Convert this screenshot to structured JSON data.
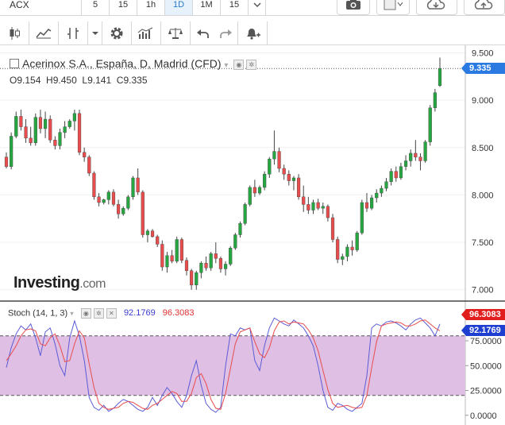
{
  "toolbar": {
    "symbol": "ACX",
    "timeframes": [
      {
        "label": "5",
        "active": false
      },
      {
        "label": "15",
        "active": false
      },
      {
        "label": "1h",
        "active": false
      },
      {
        "label": "1D",
        "active": true
      },
      {
        "label": "1M",
        "active": false
      },
      {
        "label": "15",
        "active": false
      }
    ],
    "icons": [
      "candlestick-icon",
      "line-chart-icon",
      "bar-chart-icon",
      "chevron-down-icon",
      "gear-icon",
      "indicators-icon",
      "scales-icon",
      "undo-icon",
      "redo-icon",
      "alert-bell-icon"
    ],
    "right_icons": [
      "camera-icon",
      "chart-type-icon",
      "cloud-download-icon",
      "cloud-upload-icon"
    ]
  },
  "main_panel": {
    "legend": "Acerinox S.A., España, D, Madrid (CFD)",
    "ohlc": {
      "o": "O9.154",
      "h": "H9.450",
      "l": "L9.141",
      "c": "C9.335"
    },
    "last_price": "9.335",
    "price_axis": [
      "9.500",
      "9.000",
      "8.500",
      "8.000",
      "7.500",
      "7.000"
    ],
    "logo": "Investing",
    "logo_suffix": ".com"
  },
  "stoch_panel": {
    "label": "Stoch (14, 1, 3)",
    "k_value": "92.1769",
    "d_value": "96.3083",
    "axis": [
      "75.0000",
      "50.0000",
      "25.0000",
      "0.0000"
    ]
  },
  "colors": {
    "up": "#26a641",
    "down": "#e84c4c",
    "k_line": "#5b5bd6",
    "d_line": "#e84c4c",
    "band": "#dfc0e4",
    "last_price_tag": "#2a7ae2"
  },
  "chart_data": [
    {
      "type": "candlestick",
      "title": "Acerinox S.A., España, D, Madrid (CFD)",
      "ylim": [
        6.88,
        9.58
      ],
      "candles": [
        [
          8.4,
          8.45,
          8.28,
          8.3
        ],
        [
          8.3,
          8.66,
          8.27,
          8.62
        ],
        [
          8.62,
          8.88,
          8.6,
          8.83
        ],
        [
          8.83,
          8.9,
          8.68,
          8.72
        ],
        [
          8.72,
          8.8,
          8.55,
          8.6
        ],
        [
          8.6,
          8.72,
          8.52,
          8.55
        ],
        [
          8.55,
          8.86,
          8.52,
          8.82
        ],
        [
          8.82,
          8.9,
          8.65,
          8.7
        ],
        [
          8.7,
          8.88,
          8.6,
          8.8
        ],
        [
          8.8,
          8.84,
          8.55,
          8.58
        ],
        [
          8.58,
          8.62,
          8.48,
          8.52
        ],
        [
          8.52,
          8.7,
          8.48,
          8.66
        ],
        [
          8.66,
          8.78,
          8.6,
          8.72
        ],
        [
          8.72,
          8.8,
          8.7,
          8.78
        ],
        [
          8.78,
          8.9,
          8.68,
          8.86
        ],
        [
          8.86,
          8.9,
          8.42,
          8.45
        ],
        [
          8.45,
          8.5,
          8.35,
          8.4
        ],
        [
          8.4,
          8.42,
          8.2,
          8.23
        ],
        [
          8.23,
          8.25,
          7.95,
          7.98
        ],
        [
          7.98,
          8.02,
          7.88,
          7.92
        ],
        [
          7.92,
          7.96,
          7.9,
          7.95
        ],
        [
          7.95,
          8.05,
          7.9,
          8.03
        ],
        [
          8.03,
          8.06,
          7.88,
          7.9
        ],
        [
          7.9,
          7.95,
          7.75,
          7.8
        ],
        [
          7.8,
          7.88,
          7.78,
          7.86
        ],
        [
          7.86,
          8.0,
          7.84,
          7.98
        ],
        [
          7.98,
          8.2,
          7.95,
          8.18
        ],
        [
          8.18,
          8.28,
          8.0,
          8.03
        ],
        [
          8.03,
          8.05,
          7.55,
          7.58
        ],
        [
          7.58,
          7.64,
          7.5,
          7.62
        ],
        [
          7.62,
          7.64,
          7.55,
          7.56
        ],
        [
          7.56,
          7.58,
          7.45,
          7.48
        ],
        [
          7.48,
          7.52,
          7.2,
          7.24
        ],
        [
          7.24,
          7.4,
          7.18,
          7.36
        ],
        [
          7.36,
          7.42,
          7.28,
          7.3
        ],
        [
          7.3,
          7.56,
          7.28,
          7.53
        ],
        [
          7.53,
          7.55,
          7.28,
          7.31
        ],
        [
          7.31,
          7.34,
          7.15,
          7.2
        ],
        [
          7.2,
          7.22,
          7.0,
          7.05
        ],
        [
          7.05,
          7.2,
          7.0,
          7.18
        ],
        [
          7.18,
          7.3,
          7.12,
          7.28
        ],
        [
          7.28,
          7.35,
          7.2,
          7.23
        ],
        [
          7.23,
          7.4,
          7.2,
          7.38
        ],
        [
          7.38,
          7.5,
          7.28,
          7.33
        ],
        [
          7.33,
          7.35,
          7.18,
          7.22
        ],
        [
          7.22,
          7.3,
          7.15,
          7.27
        ],
        [
          7.27,
          7.46,
          7.25,
          7.44
        ],
        [
          7.44,
          7.6,
          7.42,
          7.58
        ],
        [
          7.58,
          7.72,
          7.55,
          7.7
        ],
        [
          7.7,
          7.92,
          7.68,
          7.9
        ],
        [
          7.9,
          8.1,
          7.88,
          8.08
        ],
        [
          8.08,
          8.16,
          7.98,
          8.02
        ],
        [
          8.02,
          8.1,
          8.0,
          8.08
        ],
        [
          8.08,
          8.25,
          8.05,
          8.22
        ],
        [
          8.22,
          8.4,
          8.18,
          8.38
        ],
        [
          8.38,
          8.68,
          8.32,
          8.46
        ],
        [
          8.46,
          8.5,
          8.24,
          8.28
        ],
        [
          8.28,
          8.32,
          8.16,
          8.22
        ],
        [
          8.22,
          8.26,
          8.1,
          8.15
        ],
        [
          8.15,
          8.2,
          8.05,
          8.18
        ],
        [
          8.18,
          8.22,
          7.95,
          7.98
        ],
        [
          7.98,
          8.1,
          7.82,
          7.9
        ],
        [
          7.9,
          7.98,
          7.8,
          7.84
        ],
        [
          7.84,
          7.95,
          7.8,
          7.92
        ],
        [
          7.92,
          7.96,
          7.84,
          7.86
        ],
        [
          7.86,
          7.92,
          7.8,
          7.88
        ],
        [
          7.88,
          7.9,
          7.72,
          7.76
        ],
        [
          7.76,
          7.8,
          7.5,
          7.53
        ],
        [
          7.53,
          7.56,
          7.28,
          7.32
        ],
        [
          7.32,
          7.38,
          7.26,
          7.35
        ],
        [
          7.35,
          7.48,
          7.3,
          7.45
        ],
        [
          7.45,
          7.52,
          7.36,
          7.42
        ],
        [
          7.42,
          7.62,
          7.4,
          7.6
        ],
        [
          7.6,
          7.95,
          7.58,
          7.92
        ],
        [
          7.92,
          8.02,
          7.82,
          7.86
        ],
        [
          7.86,
          8.0,
          7.84,
          7.97
        ],
        [
          7.97,
          8.06,
          7.92,
          8.02
        ],
        [
          8.02,
          8.1,
          7.98,
          8.07
        ],
        [
          8.07,
          8.18,
          8.04,
          8.14
        ],
        [
          8.14,
          8.28,
          8.1,
          8.25
        ],
        [
          8.25,
          8.3,
          8.14,
          8.18
        ],
        [
          8.18,
          8.34,
          8.16,
          8.3
        ],
        [
          8.3,
          8.42,
          8.26,
          8.36
        ],
        [
          8.36,
          8.48,
          8.3,
          8.44
        ],
        [
          8.44,
          8.58,
          8.36,
          8.4
        ],
        [
          8.4,
          8.44,
          8.26,
          8.36
        ],
        [
          8.36,
          8.58,
          8.34,
          8.56
        ],
        [
          8.56,
          8.95,
          8.52,
          8.92
        ],
        [
          8.92,
          9.12,
          8.88,
          9.08
        ],
        [
          9.154,
          9.45,
          9.141,
          9.335
        ]
      ]
    },
    {
      "type": "line",
      "title": "Stoch (14, 1, 3)",
      "ylim": [
        0,
        100
      ],
      "series": [
        {
          "name": "%K",
          "values": [
            48,
            68,
            82,
            90,
            86,
            92,
            78,
            60,
            84,
            88,
            72,
            50,
            40,
            78,
            95,
            80,
            55,
            18,
            8,
            5,
            10,
            4,
            7,
            12,
            16,
            14,
            10,
            6,
            4,
            8,
            18,
            10,
            20,
            28,
            22,
            14,
            8,
            20,
            40,
            55,
            30,
            12,
            6,
            3,
            8,
            50,
            82,
            80,
            88,
            86,
            88,
            55,
            45,
            70,
            88,
            98,
            95,
            92,
            90,
            96,
            92,
            88,
            80,
            70,
            50,
            25,
            8,
            5,
            12,
            10,
            6,
            4,
            8,
            12,
            40,
            88,
            92,
            90,
            94,
            95,
            93,
            90,
            86,
            92,
            96,
            98,
            93,
            88,
            80,
            92
          ]
        },
        {
          "name": "%D",
          "values": [
            55,
            62,
            70,
            80,
            86,
            87,
            85,
            72,
            70,
            78,
            82,
            70,
            54,
            55,
            72,
            85,
            78,
            52,
            28,
            12,
            8,
            6,
            7,
            8,
            12,
            14,
            13,
            10,
            7,
            6,
            10,
            12,
            16,
            20,
            24,
            22,
            14,
            14,
            22,
            38,
            42,
            32,
            16,
            7,
            6,
            22,
            47,
            72,
            84,
            86,
            88,
            74,
            62,
            58,
            68,
            85,
            94,
            95,
            92,
            94,
            93,
            92,
            86,
            78,
            65,
            45,
            26,
            12,
            8,
            9,
            10,
            8,
            7,
            8,
            20,
            48,
            74,
            90,
            92,
            93,
            94,
            93,
            90,
            90,
            92,
            95,
            96,
            92,
            88,
            85
          ]
        }
      ]
    }
  ]
}
